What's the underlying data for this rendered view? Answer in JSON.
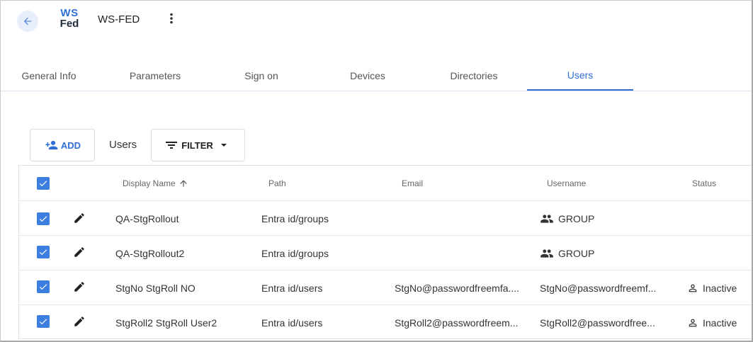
{
  "header": {
    "logo_line1": "WS",
    "logo_line2": "Fed",
    "title": "WS-FED"
  },
  "tabs": [
    {
      "label": "General Info",
      "active": false
    },
    {
      "label": "Parameters",
      "active": false
    },
    {
      "label": "Sign on",
      "active": false
    },
    {
      "label": "Devices",
      "active": false
    },
    {
      "label": "Directories",
      "active": false
    },
    {
      "label": "Users",
      "active": true
    }
  ],
  "toolbar": {
    "add_label": "ADD",
    "section_label": "Users",
    "filter_label": "FILTER"
  },
  "table": {
    "columns": {
      "display_name": "Display Name",
      "path": "Path",
      "email": "Email",
      "username": "Username",
      "status": "Status"
    },
    "sort": {
      "column": "Display Name",
      "direction": "ascending"
    },
    "rows": [
      {
        "display_name": "QA-StgRollout",
        "path": "Entra id/groups",
        "email": "",
        "username": "GROUP",
        "status": "",
        "checked": true
      },
      {
        "display_name": "QA-StgRollout2",
        "path": "Entra id/groups",
        "email": "",
        "username": "GROUP",
        "status": "",
        "checked": true
      },
      {
        "display_name": "StgNo StgRoll NO",
        "path": "Entra id/users",
        "email": "StgNo@passwordfreemfa....",
        "username": "StgNo@passwordfreemf...",
        "status": "Inactive",
        "checked": true
      },
      {
        "display_name": "StgRoll2 StgRoll User2",
        "path": "Entra id/users",
        "email": "StgRoll2@passwordfreem...",
        "username": "StgRoll2@passwordfree...",
        "status": "Inactive",
        "checked": true
      }
    ]
  },
  "colors": {
    "accent": "#2f6fd6",
    "checkbox": "#3c7fe0",
    "logo_dark": "#1d2b3a"
  },
  "icons": {
    "back": "arrow-left-icon",
    "menu": "more-vert-icon",
    "add": "person-add-icon",
    "filter": "filter-lines-icon",
    "dropdown": "caret-down-icon",
    "sort": "arrow-up-icon",
    "edit": "pencil-icon",
    "group": "people-icon",
    "user": "person-outline-icon",
    "check": "check-icon"
  }
}
